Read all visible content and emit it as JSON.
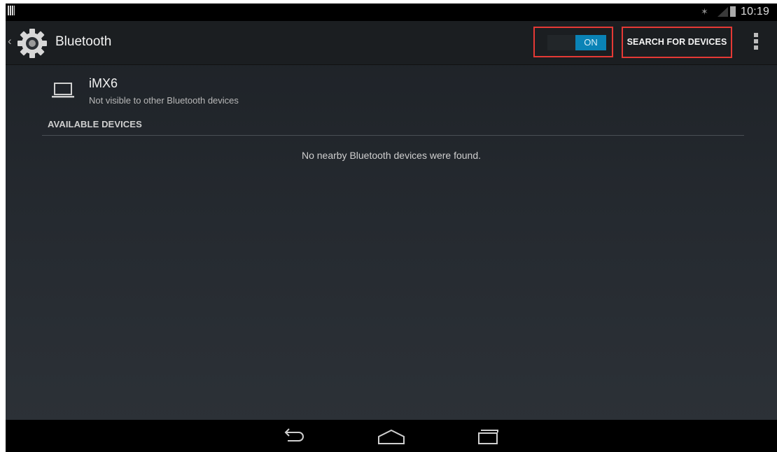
{
  "status_bar": {
    "time": "10:19",
    "icons": [
      "notification-icon",
      "bluetooth-icon",
      "signal-icon",
      "battery-icon"
    ]
  },
  "action_bar": {
    "title": "Bluetooth",
    "toggle": {
      "label": "ON",
      "state": "on"
    },
    "search_button": "SEARCH FOR DEVICES",
    "overflow_icon": "overflow-menu-icon"
  },
  "device": {
    "name": "iMX6",
    "subtitle": "Not visible to other Bluetooth devices",
    "icon": "laptop-icon"
  },
  "available_devices": {
    "header": "AVAILABLE DEVICES",
    "empty_message": "No nearby Bluetooth devices were found."
  },
  "navigation": {
    "buttons": [
      "back-icon",
      "home-icon",
      "recents-icon"
    ]
  },
  "colors": {
    "accent": "#0a83b6",
    "highlight_border": "#e53935",
    "background": "#262b31"
  }
}
